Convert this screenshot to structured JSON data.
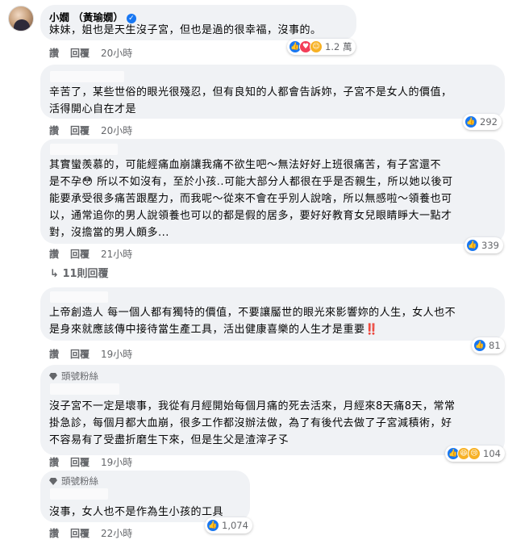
{
  "comment1": {
    "author": "小嫺 （黃瑜嫺）",
    "text": "妹妹，姐也是天生沒子宮，但也是過的很幸福，沒事的。",
    "actions": {
      "like": "讚",
      "reply": "回覆",
      "time": "20小時"
    },
    "reactions": {
      "icons": [
        "like-icon",
        "love-icon",
        "care-icon"
      ],
      "count": "1.2 萬"
    }
  },
  "comment2": {
    "lines": [
      "辛苦了，某些世俗的眼光很殘忍，但有良知的人都會告訴妳，子宮不是女人的價值，",
      "活得開心自在才是"
    ],
    "actions": {
      "like": "讚",
      "reply": "回覆",
      "time": "20小時"
    },
    "reactions": {
      "icons": [
        "like-icon"
      ],
      "count": "292"
    }
  },
  "comment3": {
    "lines": [
      "其實蠻羨慕的，可能經痛血崩讓我痛不欲生吧～無法好好上班很痛苦，有子宮還不",
      "是不孕😳 所以不如沒有，至於小孩..可能大部分人都很在乎是否親生，所以她以後可",
      "能要承受很多痛苦跟壓力，而我呢～從來不會在乎別人說啥，所以無感啦～領養也可",
      "以，通常追你的男人說領養也可以的都是假的居多，要好好教育女兒眼睛睜大一點才",
      "對，沒擔當的男人頗多..."
    ],
    "actions": {
      "like": "讚",
      "reply": "回覆",
      "time": "21小時"
    },
    "reactions": {
      "icons": [
        "like-icon"
      ],
      "count": "339"
    }
  },
  "replies_link": {
    "arrow": "↳",
    "label": "11則回覆"
  },
  "comment4": {
    "lines": [
      "上帝創造人 每一個人都有獨特的價值，不要讓靨世的眼光來影響妳的人生，女人也不",
      "是身來就應該傳中接待當生產工具，活出健康喜樂的人生才是重要"
    ],
    "emphasis": "‼️",
    "actions": {
      "like": "讚",
      "reply": "回覆",
      "time": "19小時"
    },
    "reactions": {
      "icons": [
        "like-icon"
      ],
      "count": "81"
    }
  },
  "comment5": {
    "badge": "頭號粉絲",
    "lines": [
      "沒子宮不一定是壞事，我從有月經開始每個月痛的死去活來，月經來8天痛8天，常常",
      "掛急診，每個月都大血崩，很多工作都沒辦法做，為了有後代去做了子宮減積術，好",
      "不容易有了受盡折磨生下來，但是生父是渣滓孑孓"
    ],
    "actions": {
      "like": "讚",
      "reply": "回覆",
      "time": "19小時"
    },
    "reactions": {
      "icons": [
        "like-icon",
        "haha-icon",
        "sad-icon"
      ],
      "count": "104"
    }
  },
  "comment6": {
    "badge": "頭號粉絲",
    "text": "沒事，女人也不是作為生小孩的工具",
    "actions": {
      "like": "讚",
      "reply": "回覆",
      "time": "22小時"
    },
    "reactions": {
      "icons": [
        "like-icon"
      ],
      "count": "1,074"
    }
  },
  "colors": {
    "bubble": "#f0f2f5",
    "like": "#1877f2",
    "love": "#f33e58",
    "meta": "#65676b"
  }
}
